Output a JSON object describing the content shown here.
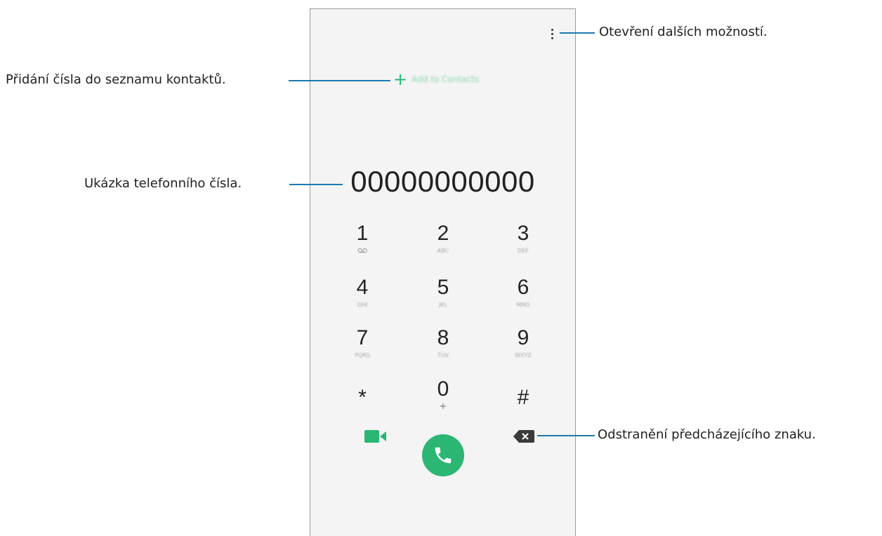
{
  "dialer": {
    "add_to_contacts_label": "Add to Contacts",
    "add_icon_glyph": "+",
    "number": "00000000000",
    "keys": [
      {
        "digit": "1",
        "sub": "",
        "sub_icon": "voicemail-icon"
      },
      {
        "digit": "2",
        "sub": "ABC"
      },
      {
        "digit": "3",
        "sub": "DEF"
      },
      {
        "digit": "4",
        "sub": "GHI"
      },
      {
        "digit": "5",
        "sub": "JKL"
      },
      {
        "digit": "6",
        "sub": "MNO"
      },
      {
        "digit": "7",
        "sub": "PQRS"
      },
      {
        "digit": "8",
        "sub": "TUV"
      },
      {
        "digit": "9",
        "sub": "WXYZ"
      },
      {
        "digit": "*",
        "sub": ""
      },
      {
        "digit": "0",
        "sub": "+"
      },
      {
        "digit": "#",
        "sub": ""
      }
    ],
    "icons": {
      "more": "more-options-icon",
      "video": "video-call-icon",
      "call": "phone-call-icon",
      "backspace": "backspace-icon"
    }
  },
  "callouts": {
    "more_options": "Otevření dalších možností.",
    "add_contact": "Přidání čísla do seznamu kontaktů.",
    "number_preview": "Ukázka telefonního čísla.",
    "delete_char": "Odstranění předcházejícího znaku."
  },
  "colors": {
    "accent_green": "#2bb673",
    "leader_line": "#1a7ab0",
    "screen_background": "#f3f4f3"
  }
}
